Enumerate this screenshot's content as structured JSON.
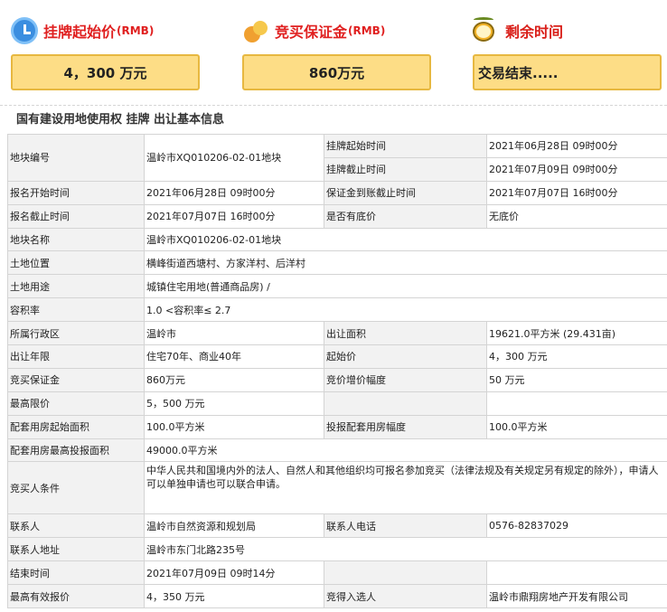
{
  "summary": {
    "start_price": {
      "label": "挂牌起始价",
      "unit": "(RMB)",
      "value": "4，300 万元"
    },
    "deposit": {
      "label": "竞买保证金",
      "unit": "(RMB)",
      "value": "860万元"
    },
    "remaining": {
      "label": "剩余时间",
      "value": "交易结束....."
    }
  },
  "section_title": "国有建设用地使用权 挂牌 出让基本信息",
  "rows": {
    "r1": {
      "k1": "地块编号",
      "v1": "温岭市XQ010206-02-01地块",
      "k2": "挂牌起始时间",
      "v2": "2021年06月28日 09时00分"
    },
    "r2": {
      "k2": "挂牌截止时间",
      "v2": "2021年07月09日 09时00分"
    },
    "r3": {
      "k1": "报名开始时间",
      "v1": "2021年06月28日 09时00分",
      "k2": "保证金到账截止时间",
      "v2": "2021年07月07日 16时00分"
    },
    "r4": {
      "k1": "报名截止时间",
      "v1": "2021年07月07日 16时00分",
      "k2": "是否有底价",
      "v2": "无底价"
    },
    "r5": {
      "k1": "地块名称",
      "v1": "温岭市XQ010206-02-01地块"
    },
    "r6": {
      "k1": "土地位置",
      "v1": "横峰街道西塘村、方家洋村、后洋村"
    },
    "r7": {
      "k1": "土地用途",
      "v1": "城镇住宅用地(普通商品房) /"
    },
    "r8": {
      "k1": "容积率",
      "v1": "1.0 <容积率≤ 2.7"
    },
    "r9": {
      "k1": "所属行政区",
      "v1": "温岭市",
      "k2": "出让面积",
      "v2": "19621.0平方米 (29.431亩)"
    },
    "r10": {
      "k1": "出让年限",
      "v1": "住宅70年、商业40年",
      "k2": "起始价",
      "v2": "4，300 万元"
    },
    "r11": {
      "k1": "竞买保证金",
      "v1": "860万元",
      "k2": "竞价增价幅度",
      "v2": "50 万元"
    },
    "r12": {
      "k1": "最高限价",
      "v1": "5，500 万元"
    },
    "r13": {
      "k1": "配套用房起始面积",
      "v1": "100.0平方米",
      "k2": "投报配套用房幅度",
      "v2": "100.0平方米"
    },
    "r14": {
      "k1": "配套用房最高投报面积",
      "v1": "49000.0平方米"
    },
    "r15": {
      "k1": "竞买人条件",
      "v1": "中华人民共和国境内外的法人、自然人和其他组织均可报名参加竞买（法律法规及有关规定另有规定的除外），申请人可以单独申请也可以联合申请。"
    },
    "r16": {
      "k1": "联系人",
      "v1": "温岭市自然资源和规划局",
      "k2": "联系人电话",
      "v2": "0576-82837029"
    },
    "r17": {
      "k1": "联系人地址",
      "v1": "温岭市东门北路235号"
    },
    "r18": {
      "k1": "结束时间",
      "v1": "2021年07月09日 09时14分"
    },
    "r19": {
      "k1": "最高有效报价",
      "v1": "4，350 万元",
      "k2": "竞得入选人",
      "v2": "温岭市鼎翔房地产开发有限公司"
    }
  }
}
